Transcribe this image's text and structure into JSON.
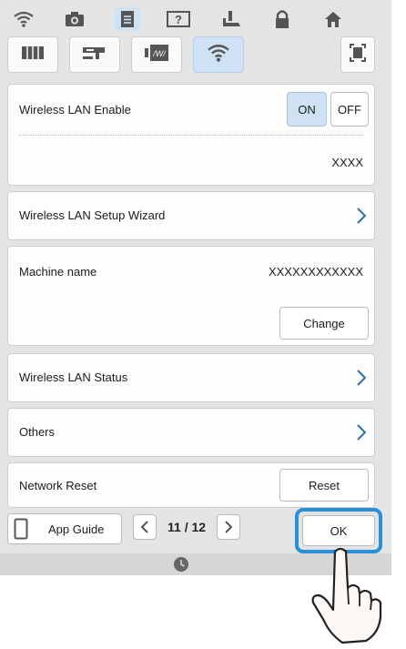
{
  "topbar": {
    "icons": [
      "wifi-icon",
      "camera-icon",
      "document-icon",
      "help-screen-icon",
      "presser-foot-icon",
      "lock-icon",
      "home-icon"
    ],
    "selected": "document-icon"
  },
  "tabs": {
    "icons": [
      "machine-settings-icon",
      "sewing-settings-icon",
      "embroidery-frame-icon",
      "wifi-icon"
    ],
    "selected": "wifi-icon",
    "screenshot_icon": "screen-capture-icon"
  },
  "wlan_enable": {
    "label": "Wireless LAN Enable",
    "on_label": "ON",
    "off_label": "OFF",
    "state": "ON",
    "network_value": "XXXX"
  },
  "setup_wizard": {
    "label": "Wireless LAN Setup Wizard"
  },
  "machine_name": {
    "label": "Machine name",
    "value": "XXXXXXXXXXXX",
    "change_label": "Change"
  },
  "wlan_status": {
    "label": "Wireless LAN Status"
  },
  "others": {
    "label": "Others"
  },
  "network_reset": {
    "label": "Network Reset",
    "reset_label": "Reset"
  },
  "footer": {
    "app_guide_label": "App Guide",
    "page_current": "11",
    "page_separator": "/",
    "page_total": "12",
    "ok_label": "OK",
    "clock_icon": "clock-icon"
  },
  "colors": {
    "selected_bg": "#cfe2f3",
    "highlight_ring": "#2a90d8",
    "chevron": "#2f6fb0"
  }
}
